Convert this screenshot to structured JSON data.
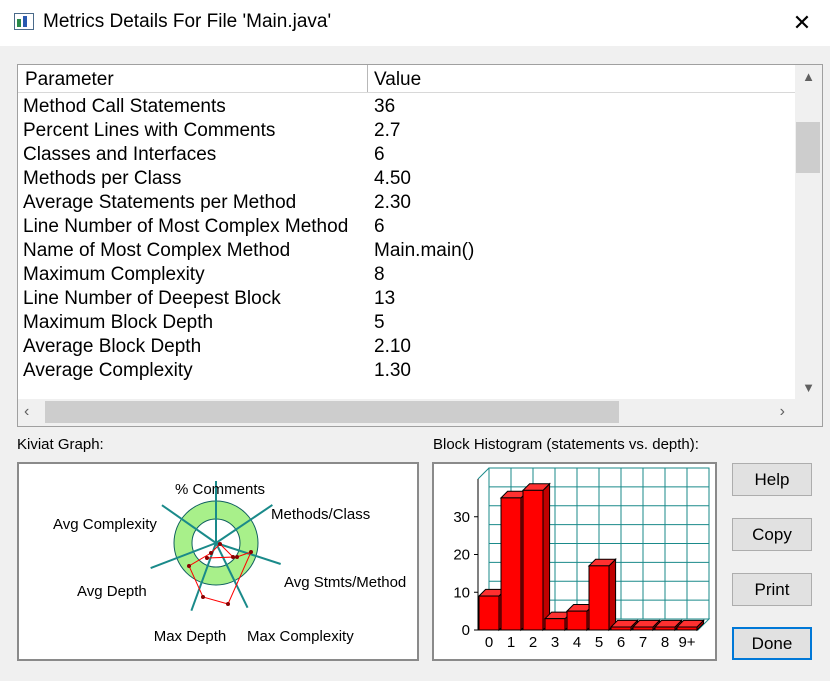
{
  "window": {
    "title": "Metrics Details For File 'Main.java'",
    "close_glyph": "✕"
  },
  "table": {
    "headers": {
      "parameter": "Parameter",
      "value": "Value"
    },
    "rows": [
      {
        "param": "Method Call Statements",
        "value": "36"
      },
      {
        "param": "Percent Lines with Comments",
        "value": "2.7"
      },
      {
        "param": "Classes and Interfaces",
        "value": "6"
      },
      {
        "param": "Methods per Class",
        "value": "4.50"
      },
      {
        "param": "Average Statements per Method",
        "value": "2.30"
      },
      {
        "param": "Line Number of Most Complex Method",
        "value": "6"
      },
      {
        "param": "Name of Most Complex Method",
        "value": "Main.main()"
      },
      {
        "param": "Maximum Complexity",
        "value": "8"
      },
      {
        "param": "Line Number of Deepest Block",
        "value": "13"
      },
      {
        "param": "Maximum Block Depth",
        "value": "5"
      },
      {
        "param": "Average Block Depth",
        "value": "2.10"
      },
      {
        "param": "Average Complexity",
        "value": "1.30"
      }
    ]
  },
  "kiviat": {
    "label": "Kiviat Graph:",
    "axes": [
      "% Comments",
      "Methods/Class",
      "Avg Stmts/Method",
      "Max Complexity",
      "Max Depth",
      "Avg Depth",
      "Avg Complexity"
    ],
    "colors": {
      "outer_ring": "#a8f08a",
      "inner": "#ffffff",
      "axis": "#1a8a8a",
      "polygon": "#ff0000"
    }
  },
  "histogram": {
    "label": "Block Histogram (statements vs. depth):",
    "colors": {
      "bar": "#ff0000",
      "grid": "#1a8a8a",
      "axis": "#000000"
    }
  },
  "chart_data": [
    {
      "type": "bar",
      "categories": [
        "0",
        "1",
        "2",
        "3",
        "4",
        "5",
        "6",
        "7",
        "8",
        "9+"
      ],
      "values": [
        9,
        35,
        37,
        3,
        5,
        17,
        0,
        0,
        0,
        0
      ],
      "title": "Block Histogram (statements vs. depth):",
      "ylim": [
        0,
        40
      ],
      "yticks": [
        "0",
        "10",
        "20",
        "30"
      ],
      "grid": true
    }
  ],
  "buttons": {
    "help": "Help",
    "copy": "Copy",
    "print": "Print",
    "done": "Done"
  }
}
